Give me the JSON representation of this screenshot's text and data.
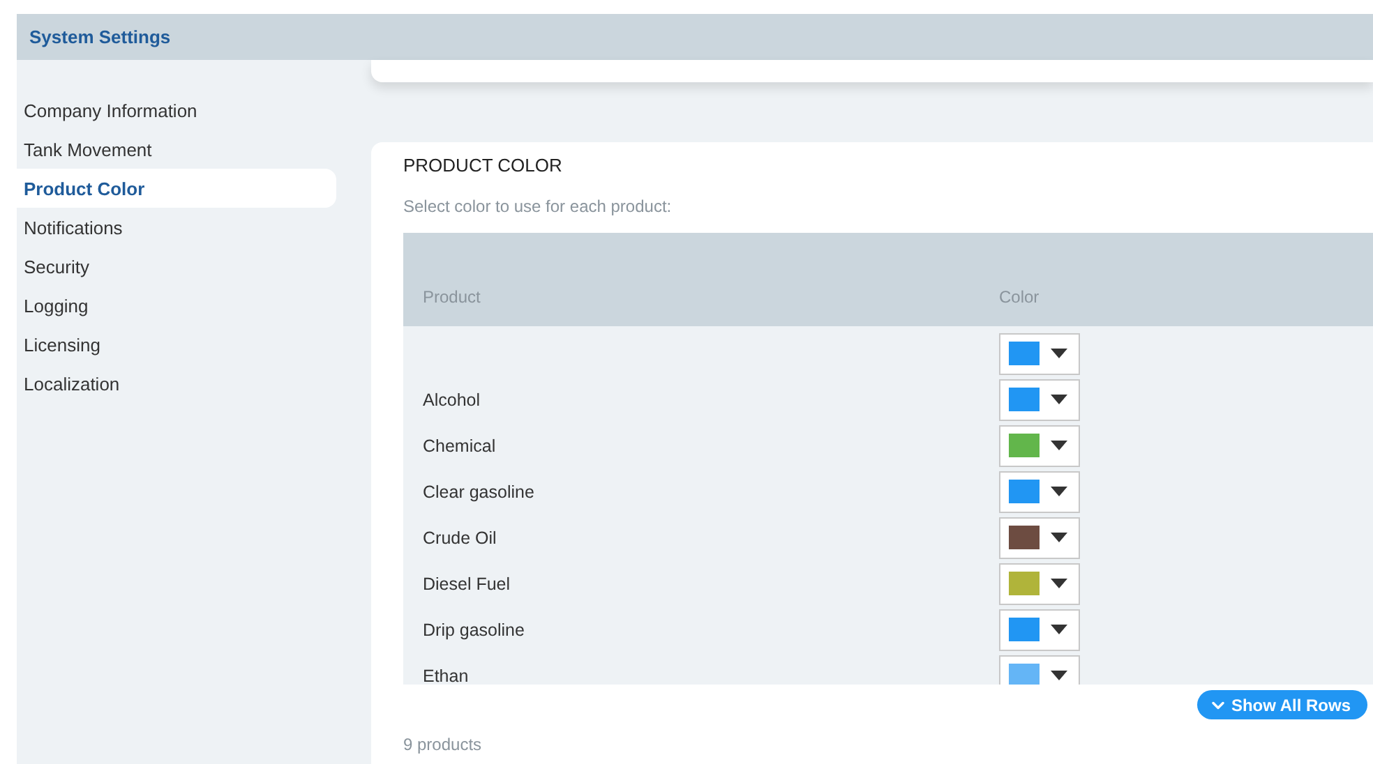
{
  "header": {
    "title": "System Settings"
  },
  "sidebar": {
    "items": [
      {
        "label": "Company Information",
        "selected": false
      },
      {
        "label": "Tank Movement",
        "selected": false
      },
      {
        "label": "Product Color",
        "selected": true
      },
      {
        "label": "Notifications",
        "selected": false
      },
      {
        "label": "Security",
        "selected": false
      },
      {
        "label": "Logging",
        "selected": false
      },
      {
        "label": "Licensing",
        "selected": false
      },
      {
        "label": "Localization",
        "selected": false
      }
    ]
  },
  "panel": {
    "title": "PRODUCT COLOR",
    "subtitle": "Select color to use for each product:",
    "table": {
      "columns": [
        "Product",
        "Color"
      ],
      "rows": [
        {
          "product": "",
          "color": "#2196f3"
        },
        {
          "product": "Alcohol",
          "color": "#2196f3"
        },
        {
          "product": "Chemical",
          "color": "#62b64b"
        },
        {
          "product": "Clear gasoline",
          "color": "#2196f3"
        },
        {
          "product": "Crude Oil",
          "color": "#6d4c41"
        },
        {
          "product": "Diesel Fuel",
          "color": "#b0b43a"
        },
        {
          "product": "Drip gasoline",
          "color": "#2196f3"
        },
        {
          "product": "Ethan",
          "color": "#64b5f6"
        }
      ]
    },
    "show_all_button": "Show All Rows",
    "count": "9 products"
  }
}
